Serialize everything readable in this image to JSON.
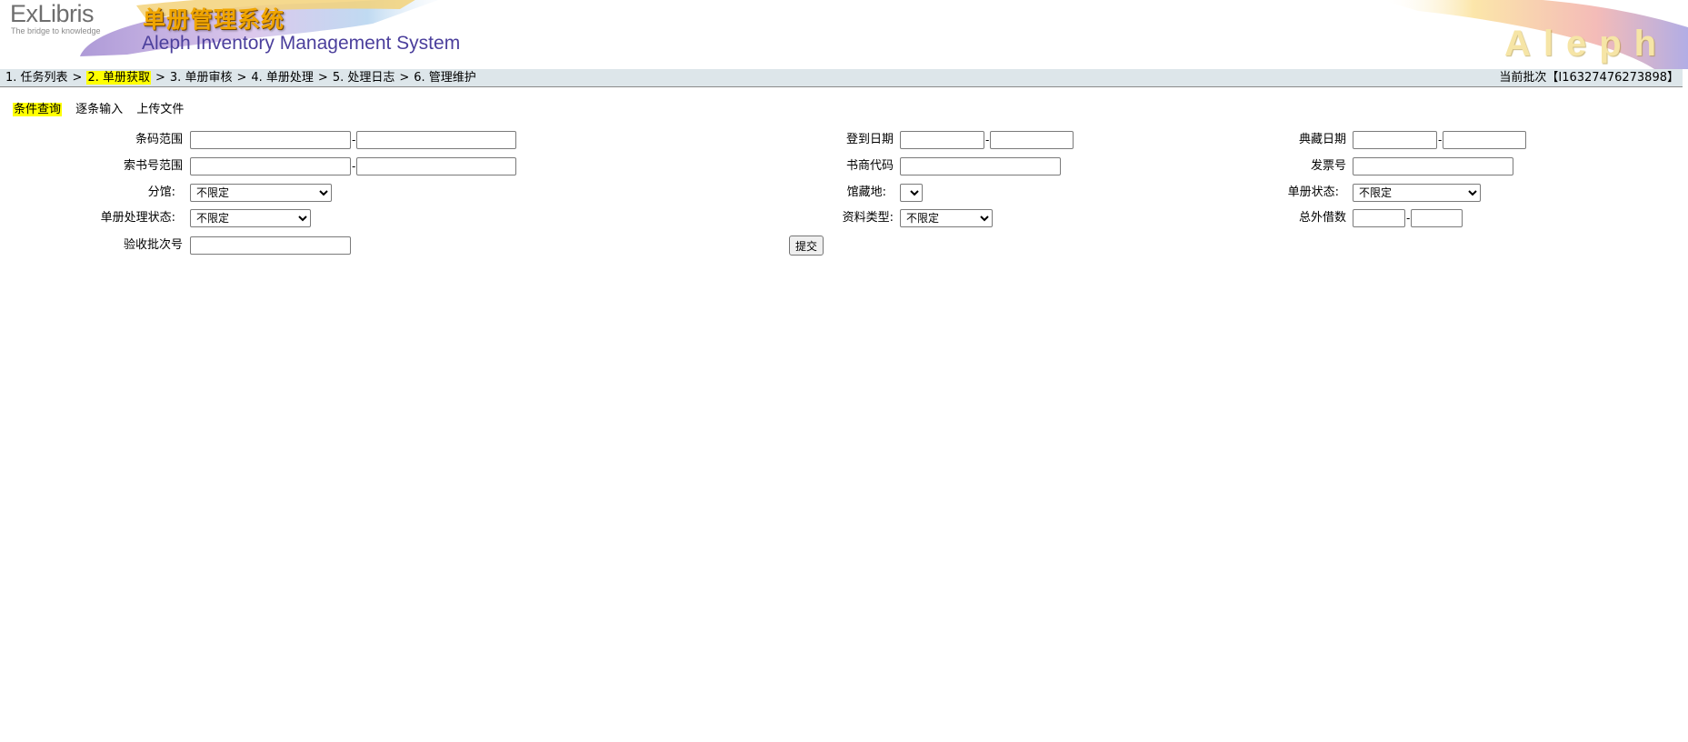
{
  "header": {
    "logo_text": "ExLibris",
    "logo_tagline": "The bridge to knowledge",
    "title_cn": "单册管理系统",
    "title_en": "Aleph Inventory Management System",
    "brand_watermark": "Aleph",
    "colors": {
      "title_cn": "#f0a500",
      "title_en": "#4b3f9c",
      "logo": "#6e6e6e"
    }
  },
  "steps": {
    "items": [
      {
        "label": "1. 任务列表",
        "active": false
      },
      {
        "label": "2. 单册获取",
        "active": true
      },
      {
        "label": "3. 单册审核",
        "active": false
      },
      {
        "label": "4. 单册处理",
        "active": false
      },
      {
        "label": "5. 处理日志",
        "active": false
      },
      {
        "label": "6. 管理维护",
        "active": false
      }
    ],
    "separator": ">",
    "current_batch": "当前批次【I16327476273898】",
    "colors": {
      "bar_bg": "#dde6ea",
      "highlight": "#ffff00"
    }
  },
  "subtabs": {
    "items": [
      {
        "label": "条件查询",
        "active": true
      },
      {
        "label": "逐条输入",
        "active": false
      },
      {
        "label": "上传文件",
        "active": false
      }
    ]
  },
  "form": {
    "barcode_range": {
      "label": "条码范围",
      "from": "",
      "to": "",
      "dash": "-"
    },
    "callno_range": {
      "label": "索书号范围",
      "from": "",
      "to": "",
      "dash": "-"
    },
    "branch": {
      "label": "分馆:",
      "selected": "不限定"
    },
    "item_process_status": {
      "label": "单册处理状态:",
      "selected": "不限定"
    },
    "acceptance_batch_no": {
      "label": "验收批次号",
      "value": ""
    },
    "arrival_date": {
      "label": "登到日期",
      "from": "",
      "to": "",
      "dash": "-"
    },
    "vendor_code": {
      "label": "书商代码",
      "value": ""
    },
    "collection": {
      "label": "馆藏地:",
      "selected": ""
    },
    "material_type": {
      "label": "资料类型:",
      "selected": "不限定"
    },
    "submit_label": "提交",
    "shelving_date": {
      "label": "典藏日期",
      "from": "",
      "to": "",
      "dash": "-"
    },
    "invoice_no": {
      "label": "发票号",
      "value": ""
    },
    "item_status": {
      "label": "单册状态:",
      "selected": "不限定"
    },
    "total_loans": {
      "label": "总外借数",
      "from": "",
      "to": "",
      "dash": "-"
    }
  }
}
